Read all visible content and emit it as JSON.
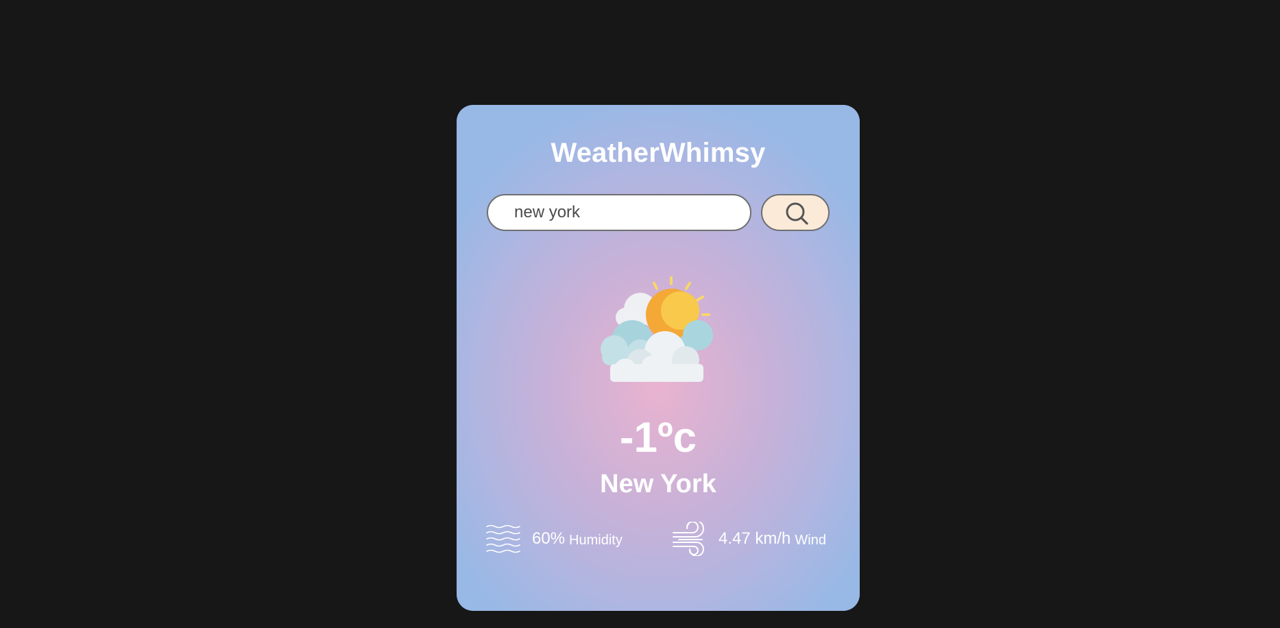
{
  "app": {
    "title": "WeatherWhimsy"
  },
  "search": {
    "value": "new york",
    "button_icon": "search-icon"
  },
  "weather": {
    "icon": "partly-cloudy-sun-icon",
    "temperature": "-1ºc",
    "city": "New York"
  },
  "details": {
    "humidity": {
      "icon": "humidity-waves-icon",
      "value": "60%",
      "label": "Humidity"
    },
    "wind": {
      "icon": "wind-icon",
      "value": "4.47 km/h",
      "label": "Wind"
    }
  },
  "colors": {
    "page_background": "#171717",
    "card_gradient_center": "#e9b3cf",
    "card_gradient_edge": "#98b8e6",
    "search_button_bg": "#fbead8",
    "text": "#ffffff"
  }
}
